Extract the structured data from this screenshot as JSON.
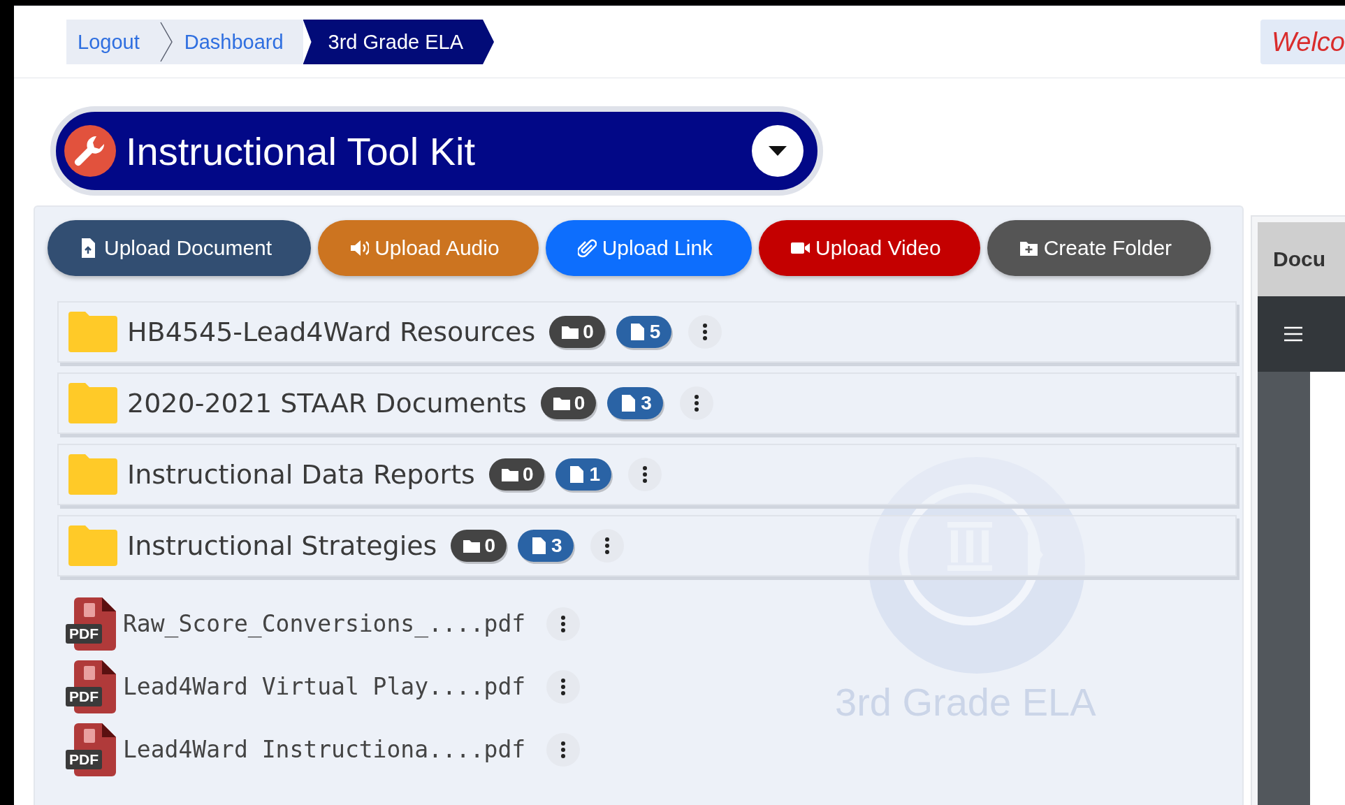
{
  "breadcrumb": [
    {
      "label": "Logout",
      "selected": false
    },
    {
      "label": "Dashboard",
      "selected": false
    },
    {
      "label": "3rd Grade ELA",
      "selected": true
    }
  ],
  "welcome": "Welco",
  "toolkit": {
    "title": "Instructional Tool Kit"
  },
  "buttons": [
    {
      "label": "Upload Document",
      "kind": "document"
    },
    {
      "label": "Upload Audio",
      "kind": "audio"
    },
    {
      "label": "Upload Link",
      "kind": "link"
    },
    {
      "label": "Upload Video",
      "kind": "video"
    },
    {
      "label": "Create Folder",
      "kind": "folder"
    }
  ],
  "folders": [
    {
      "name": "HB4545-Lead4Ward Resources",
      "folder_count": "0",
      "file_count": "5"
    },
    {
      "name": "2020-2021 STAAR Documents",
      "folder_count": "0",
      "file_count": "3"
    },
    {
      "name": "Instructional Data Reports",
      "folder_count": "0",
      "file_count": "1"
    },
    {
      "name": "Instructional Strategies",
      "folder_count": "0",
      "file_count": "3"
    }
  ],
  "files": [
    {
      "name": "Raw_Score_Conversions_....pdf",
      "type_label": "PDF"
    },
    {
      "name": "Lead4Ward Virtual Play....pdf",
      "type_label": "PDF"
    },
    {
      "name": "Lead4Ward Instructiona....pdf",
      "type_label": "PDF"
    }
  ],
  "background_logo": {
    "caption": "3rd Grade ELA"
  },
  "preview_panel": {
    "title": "Docu"
  }
}
